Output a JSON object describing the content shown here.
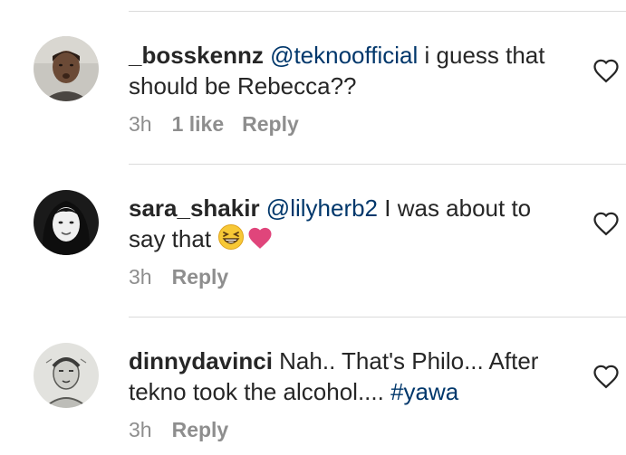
{
  "comments": [
    {
      "username": "_bosskennz",
      "mention": "@teknoofficial",
      "text_line1": " i guess that",
      "text_line2": "should be Rebecca??",
      "time": "3h",
      "likes": "1 like",
      "reply": "Reply",
      "avatar_icon": "profile-photo-man",
      "like_icon": "heart-outline-icon"
    },
    {
      "username": "sara_shakir",
      "mention": "@lilyherb2",
      "text_line1": " I was about to",
      "text_line2": "say that ",
      "emojis": [
        "grinning-squinting-face-icon",
        "pink-heart-icon"
      ],
      "time": "3h",
      "reply": "Reply",
      "avatar_icon": "profile-photo-woman",
      "like_icon": "heart-outline-icon"
    },
    {
      "username": "dinnydavinci",
      "text_line1": " Nah.. That's Philo... After",
      "text_line2": "tekno took the alcohol.... ",
      "hashtag": "#yawa",
      "time": "3h",
      "reply": "Reply",
      "avatar_icon": "profile-photo-sketch",
      "like_icon": "heart-outline-icon"
    }
  ],
  "colors": {
    "text": "#262626",
    "link": "#00376b",
    "meta": "#8e8e8e",
    "divider": "#dbdbdb",
    "heart_emoji": "#e0457b"
  }
}
